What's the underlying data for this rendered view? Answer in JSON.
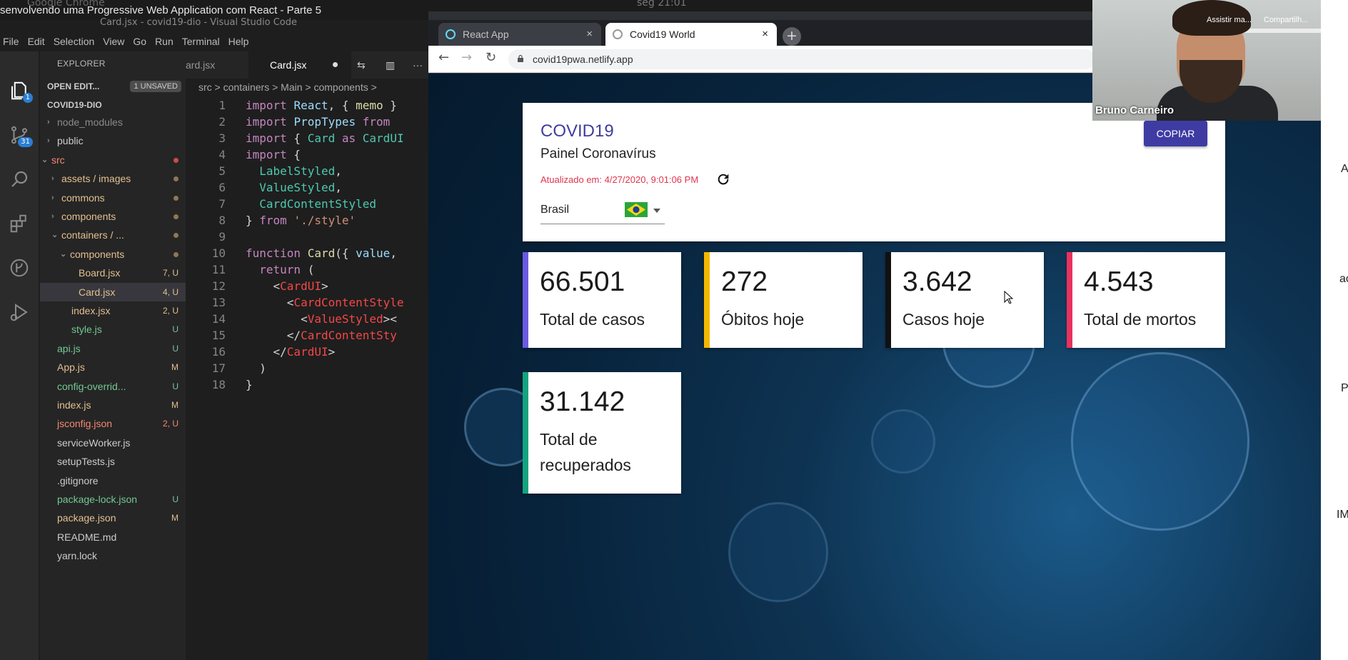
{
  "video_title": "senvolvendo uma Progressive Web Application com React - Parte 5",
  "os": {
    "app_label": "Google Chrome",
    "clock": "seg 21:01"
  },
  "vscode": {
    "window_title": "Card.jsx - covid19-dio - Visual Studio Code",
    "menu": [
      "File",
      "Edit",
      "Selection",
      "View",
      "Go",
      "Run",
      "Terminal",
      "Help"
    ],
    "scm_badge": "31",
    "explorer_badge": "1",
    "explorer_label": "EXPLORER",
    "open_editors": "OPEN EDIT...",
    "unsaved": "1 UNSAVED",
    "project": "COVID19-DIO",
    "tree": [
      {
        "name": "node_modules",
        "status": "",
        "color": "dim"
      },
      {
        "name": "public",
        "status": "",
        "color": "plain"
      },
      {
        "name": "src",
        "status": "",
        "color": "err"
      },
      {
        "name": "assets / images",
        "status": "",
        "color": "mod"
      },
      {
        "name": "commons",
        "status": "",
        "color": "mod"
      },
      {
        "name": "components",
        "status": "",
        "color": "mod"
      },
      {
        "name": "containers / ...",
        "status": "",
        "color": "mod"
      },
      {
        "name": "components",
        "status": "",
        "color": "mod"
      },
      {
        "name": "Board.jsx",
        "status": "7, U",
        "color": "mod"
      },
      {
        "name": "Card.jsx",
        "status": "4, U",
        "color": "mod"
      },
      {
        "name": "index.jsx",
        "status": "2, U",
        "color": "mod"
      },
      {
        "name": "style.js",
        "status": "U",
        "color": "unt"
      },
      {
        "name": "api.js",
        "status": "U",
        "color": "unt"
      },
      {
        "name": "App.js",
        "status": "M",
        "color": "mod"
      },
      {
        "name": "config-overrid...",
        "status": "U",
        "color": "unt"
      },
      {
        "name": "index.js",
        "status": "M",
        "color": "mod"
      },
      {
        "name": "jsconfig.json",
        "status": "2, U",
        "color": "err"
      },
      {
        "name": "serviceWorker.js",
        "status": "",
        "color": "plain"
      },
      {
        "name": "setupTests.js",
        "status": "",
        "color": "plain"
      },
      {
        "name": ".gitignore",
        "status": "",
        "color": "plain"
      },
      {
        "name": "package-lock.json",
        "status": "U",
        "color": "unt"
      },
      {
        "name": "package.json",
        "status": "M",
        "color": "mod"
      },
      {
        "name": "README.md",
        "status": "",
        "color": "plain"
      },
      {
        "name": "yarn.lock",
        "status": "",
        "color": "plain"
      }
    ],
    "tabs": [
      "ard.jsx",
      "Card.jsx"
    ],
    "breadcrumb": "src > containers > Main > components >",
    "line_numbers": [
      "1",
      "2",
      "3",
      "4",
      "5",
      "6",
      "7",
      "8",
      "9",
      "10",
      "11",
      "12",
      "13",
      "14",
      "15",
      "16",
      "17",
      "18"
    ]
  },
  "browser": {
    "tab1": "React App",
    "tab2": "Covid19 World",
    "close": "×",
    "new_tab": "+",
    "url": "covid19pwa.netlify.app"
  },
  "dashboard": {
    "title": "COVID19",
    "subtitle": "Painel Coronavírus",
    "updated": "Atualizado em: 4/27/2020, 9:01:06 PM",
    "copy_button": "COPIAR",
    "country": "Brasil",
    "stats": [
      {
        "value": "66.501",
        "label": "Total de casos",
        "color": "#6a5ae0"
      },
      {
        "value": "272",
        "label": "Óbitos hoje",
        "color": "#f5b800"
      },
      {
        "value": "3.642",
        "label": "Casos hoje",
        "color": "#111111"
      },
      {
        "value": "4.543",
        "label": "Total de mortos",
        "color": "#e8315f"
      },
      {
        "value": "31.142",
        "label": "Total de recuperados",
        "color": "#14a37f"
      }
    ]
  },
  "webcam": {
    "name": "Bruno Carneiro",
    "label_a": "Assistir ma...",
    "label_b": "Compartilh..."
  },
  "right_side": [
    "A",
    "ac",
    "P",
    "IM"
  ]
}
